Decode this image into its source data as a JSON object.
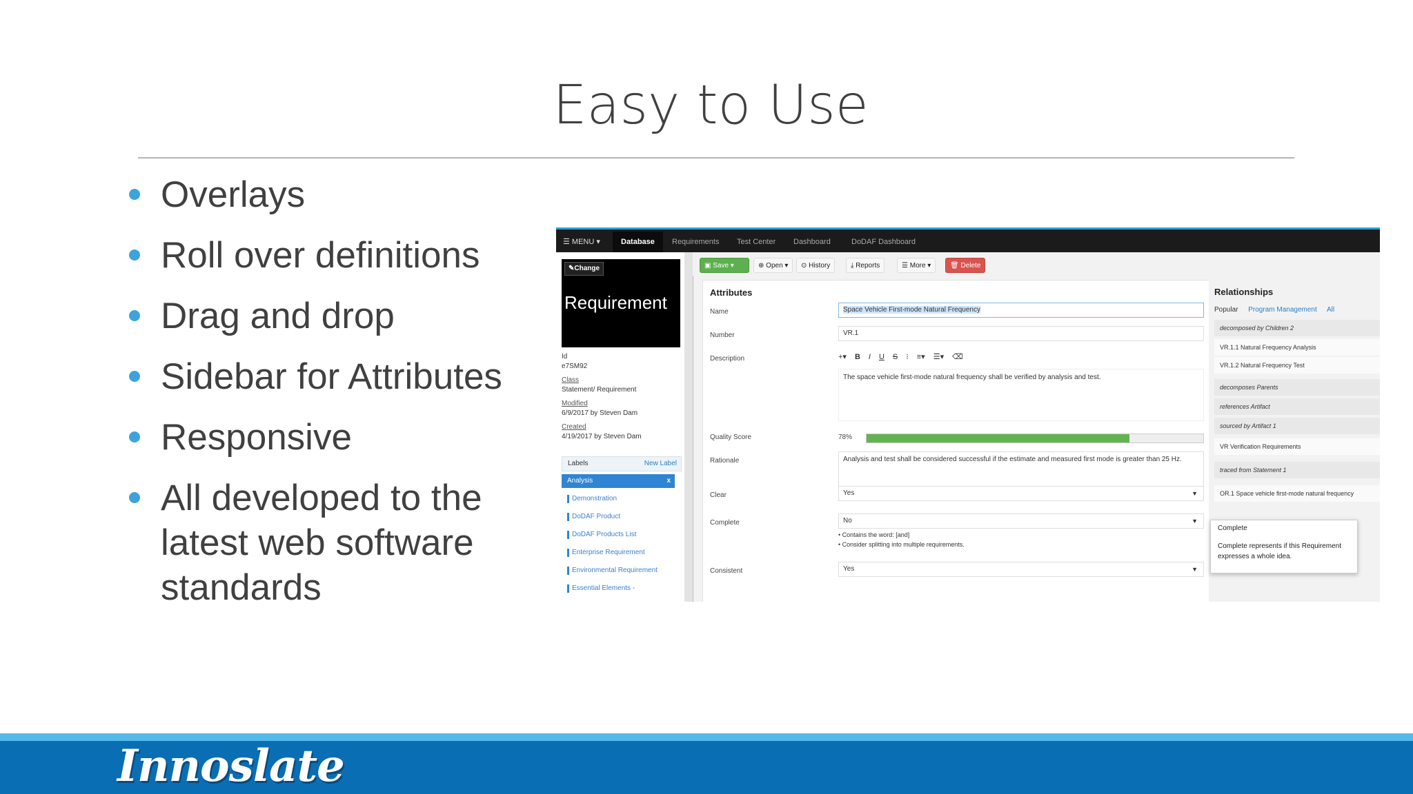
{
  "slide": {
    "title": "Easy to Use",
    "bullets": [
      "Overlays",
      "Roll over definitions",
      "Drag and drop",
      "Sidebar for Attributes",
      "Responsive",
      "All developed to the latest web software standards"
    ],
    "logo": "Innoslate"
  },
  "colors": {
    "accent_bullet": "#3ea3dc",
    "footer_blue": "#0a6eb5",
    "footer_light": "#55b9e9",
    "save_green": "#5db04e",
    "delete_red": "#d9534f",
    "progress_green": "#63b350"
  },
  "app": {
    "nav": {
      "menu": "☰ MENU ▾",
      "items": [
        "Database",
        "Requirements",
        "Test Center",
        "Dashboard",
        "DoDAF Dashboard"
      ],
      "active": "Database"
    },
    "sidebar": {
      "change_button": "Change",
      "entity_type": "Requirement",
      "id_label": "Id",
      "id_value": "e7SM92",
      "class_label": "Class",
      "class_value": "Statement/ Requirement",
      "modified_label": "Modified",
      "modified_value": "6/9/2017 by Steven Dam",
      "created_label": "Created",
      "created_value": "4/19/2017 by Steven Dam",
      "labels_title": "Labels",
      "new_label": "New Label",
      "selected_label": "Analysis",
      "labels": [
        "Demonstration",
        "DoDAF Product",
        "DoDAF Products List",
        "Enterprise Requirement",
        "Environmental Requirement",
        "Essential Elements -"
      ]
    },
    "toolbar": {
      "save": "Save",
      "open": "Open ▾",
      "history": "History",
      "reports": "Reports",
      "more": "More ▾",
      "delete": "Delete"
    },
    "attributes": {
      "title": "Attributes",
      "name_label": "Name",
      "name_value": "Space Vehicle First-mode Natural Frequency",
      "number_label": "Number",
      "number_value": "VR.1",
      "description_label": "Description",
      "description_value": "The space vehicle first-mode natural frequency shall be verified by analysis and test.",
      "quality_label": "Quality Score",
      "quality_text": "78%",
      "quality_value": 0.78,
      "rationale_label": "Rationale",
      "rationale_value": "Analysis and test shall be considered successful if the estimate and measured first mode is greater than 25 Hz.",
      "clear_label": "Clear",
      "clear_value": "Yes",
      "complete_label": "Complete",
      "complete_value": "No",
      "complete_hints": [
        "Contains the word: [and]",
        "Consider splitting into multiple requirements."
      ],
      "consistent_label": "Consistent",
      "consistent_value": "Yes"
    },
    "relationships": {
      "title": "Relationships",
      "tabs": [
        "Popular",
        "Program Management",
        "All"
      ],
      "rows": [
        "decomposed by Children 2",
        "VR.1.1 Natural Frequency Analysis",
        "VR.1.2 Natural Frequency Test",
        "decomposes Parents",
        "references Artifact",
        "sourced by Artifact 1",
        "VR Verification Requirements",
        "traced from Statement 1",
        "OR.1 Space vehicle first-mode natural frequency"
      ]
    },
    "tooltip": {
      "title": "Complete",
      "body": "Complete represents if this Requirement expresses a whole idea."
    }
  }
}
